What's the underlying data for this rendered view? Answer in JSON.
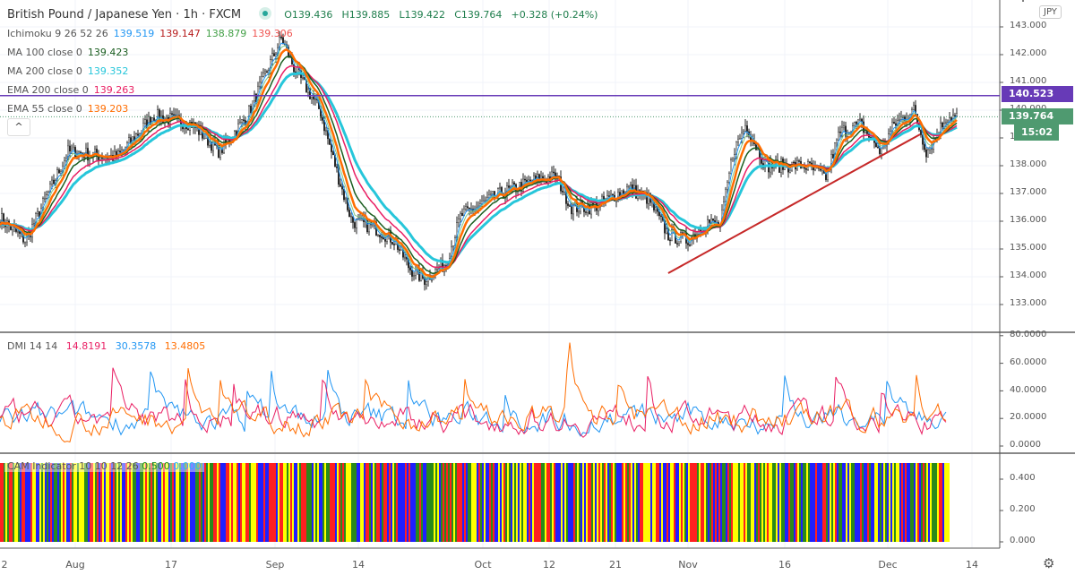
{
  "header": {
    "symbol": "British Pound / Japanese Yen · 1h · FXCM",
    "open": "O139.436",
    "high": "H139.885",
    "low": "L139.422",
    "close": "C139.764",
    "change": "+0.328 (+0.24%)"
  },
  "indicators": [
    {
      "label": "Ichimoku 9 26 52 26",
      "values": [
        {
          "v": "139.519",
          "color": "#2196f3"
        },
        {
          "v": "139.147",
          "color": "#b71c1c"
        },
        {
          "v": "138.879",
          "color": "#43a047"
        },
        {
          "v": "139.306",
          "color": "#ef5350"
        }
      ]
    },
    {
      "label": "MA 100 close 0",
      "values": [
        {
          "v": "139.423",
          "color": "#1b5e20"
        }
      ]
    },
    {
      "label": "MA 200 close 0",
      "values": [
        {
          "v": "139.352",
          "color": "#26c6da"
        }
      ]
    },
    {
      "label": "EMA 200 close 0",
      "values": [
        {
          "v": "139.263",
          "color": "#e91e63"
        }
      ]
    },
    {
      "label": "EMA 55 close 0",
      "values": [
        {
          "v": "139.203",
          "color": "#ff6d00"
        }
      ]
    }
  ],
  "collapse_label": "^",
  "currency": "JPY",
  "price_axis": {
    "ticks": [
      "143.000",
      "142.000",
      "141.000",
      "140.000",
      "139.000",
      "138.000",
      "137.000",
      "136.000",
      "135.000",
      "134.000",
      "133.000"
    ],
    "line_tag": "140.523",
    "last_tag": "139.764",
    "countdown": "15:02",
    "line_color": "#673ab7",
    "last_color": "#4f9a70"
  },
  "dmi": {
    "label": "DMI 14 14",
    "values": [
      {
        "v": "14.8191",
        "color": "#e91e63"
      },
      {
        "v": "30.3578",
        "color": "#2196f3"
      },
      {
        "v": "13.4805",
        "color": "#ff6d00"
      }
    ],
    "ticks": [
      "80.0000",
      "60.0000",
      "40.0000",
      "20.0000",
      "0.0000"
    ]
  },
  "cam": {
    "label": "CAM Indicator 10 10 12 26",
    "values": [
      {
        "v": "0.500",
        "color": "#1b8a1b"
      },
      {
        "v": "0.000",
        "color": "#29b6f6"
      }
    ],
    "ticks": [
      "0.400",
      "0.200",
      "0.000"
    ],
    "colors": [
      "#ffff00",
      "#ff2020",
      "#1f1fff",
      "#2a8a1a"
    ]
  },
  "time_axis": [
    "2",
    "Aug",
    "17",
    "Sep",
    "14",
    "Oct",
    "12",
    "21",
    "Nov",
    "16",
    "Dec",
    "14"
  ],
  "chart_data": {
    "type": "candlestick",
    "price_ylim": [
      133,
      143
    ],
    "horizontal_line": 140.523,
    "trendline": [
      [
        "2020-10-29",
        134.13
      ],
      [
        "2020-12-06",
        139.13
      ]
    ],
    "price_path": [
      [
        "2020-07-21",
        136.2
      ],
      [
        "2020-07-25",
        135.3
      ],
      [
        "2020-07-31",
        138.5
      ],
      [
        "2020-08-08",
        138.3
      ],
      [
        "2020-08-14",
        139.8
      ],
      [
        "2020-08-20",
        139.5
      ],
      [
        "2020-08-24",
        138.5
      ],
      [
        "2020-08-28",
        139.8
      ],
      [
        "2020-08-31",
        141.5
      ],
      [
        "2020-09-02",
        142.6
      ],
      [
        "2020-09-04",
        141.5
      ],
      [
        "2020-09-08",
        140
      ],
      [
        "2020-09-11",
        137.5
      ],
      [
        "2020-09-13",
        136
      ],
      [
        "2020-09-16",
        135.8
      ],
      [
        "2020-09-19",
        135.3
      ],
      [
        "2020-09-21",
        134.3
      ],
      [
        "2020-09-23",
        133.9
      ],
      [
        "2020-09-26",
        134.5
      ],
      [
        "2020-09-28",
        136.2
      ],
      [
        "2020-10-04",
        137
      ],
      [
        "2020-10-10",
        137.5
      ],
      [
        "2020-10-13",
        137.6
      ],
      [
        "2020-10-15",
        136.5
      ],
      [
        "2020-10-18",
        136.5
      ],
      [
        "2020-10-23",
        137.2
      ],
      [
        "2020-10-26",
        136.8
      ],
      [
        "2020-10-29",
        135.5
      ],
      [
        "2020-11-01",
        135.3
      ],
      [
        "2020-11-04",
        136
      ],
      [
        "2020-11-06",
        135.8
      ],
      [
        "2020-11-08",
        138.5
      ],
      [
        "2020-11-10",
        139.5
      ],
      [
        "2020-11-13",
        138
      ],
      [
        "2020-11-19",
        138
      ],
      [
        "2020-11-22",
        137.6
      ],
      [
        "2020-11-24",
        139.2
      ],
      [
        "2020-11-27",
        139.5
      ],
      [
        "2020-11-30",
        138.5
      ],
      [
        "2020-12-02",
        139.5
      ],
      [
        "2020-12-05",
        140
      ],
      [
        "2020-12-07",
        138.5
      ],
      [
        "2020-12-09",
        139.3
      ],
      [
        "2020-12-10",
        139.76
      ]
    ],
    "dmi_ylim": [
      0,
      80
    ],
    "cam_ylim": [
      0,
      0.5
    ]
  }
}
